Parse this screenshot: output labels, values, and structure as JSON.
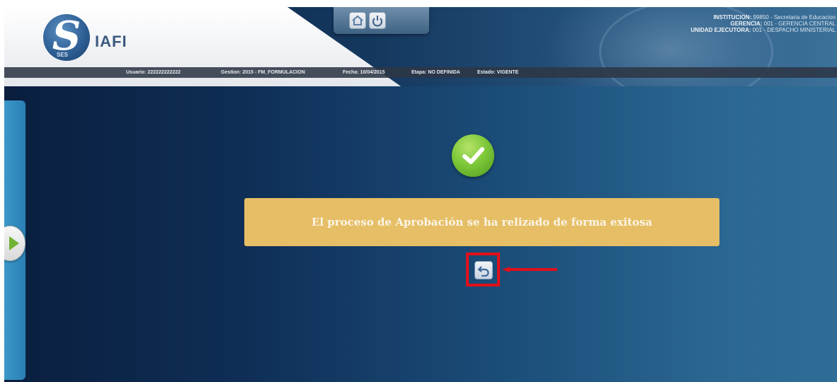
{
  "header": {
    "logo_letter": "S",
    "logo_small": "SES",
    "logo_text": "IAFI",
    "institution": {
      "line1_label": "INSTITUCION:",
      "line1_value": "99850 - Secretaria de Educacion",
      "line2_label": "GERENCIA:",
      "line2_value": "001 - GERENCIA CENTRAL",
      "line3_label": "UNIDAD EJECUTORA:",
      "line3_value": "001 - DESPACHO MINISTERIAL"
    },
    "status_bar": {
      "usuario": "Usuario: 222222222222",
      "gestion": "Gestion: 2015 - FM_FORMULACION",
      "fecha": "Fecha: 10/04/2015",
      "etapa": "Etapa: NO DEFINIDA",
      "estado": "Estado: VIGENTE"
    },
    "buttons": {
      "home_icon": "home-icon",
      "power_icon": "power-icon"
    }
  },
  "main": {
    "success_icon": "checkmark-icon",
    "message": "El proceso de Aprobación se ha relizado de forma exitosa",
    "back_icon": "undo-arrow-icon",
    "annotation": "red-arrow-pointer"
  },
  "colors": {
    "message_bg": "#e6be66",
    "highlight": "#e0101a",
    "success": "#7ec83a"
  }
}
